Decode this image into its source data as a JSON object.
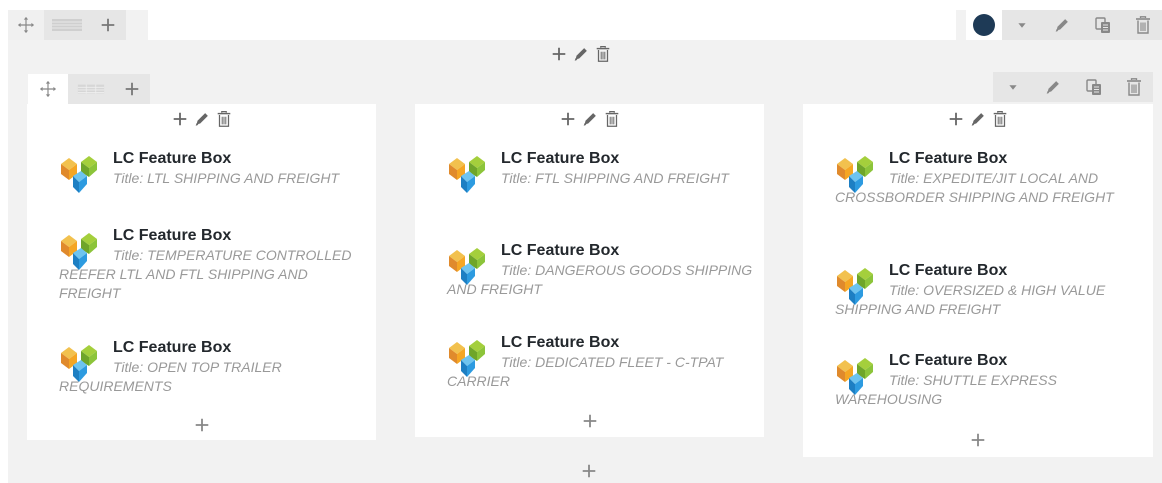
{
  "row": {
    "color_dot": "#1e3a56",
    "toolbar_icons": [
      "move-icon",
      "layout-icon",
      "plus-icon",
      "color-dot",
      "chevron-down-icon",
      "pencil-icon",
      "duplicate-icon",
      "trash-icon"
    ]
  },
  "section": {
    "toolbar_icons": [
      "move-icon",
      "layout-icon",
      "plus-icon",
      "chevron-down-icon",
      "pencil-icon",
      "duplicate-icon",
      "trash-icon"
    ]
  },
  "columns": [
    {
      "items": [
        {
          "name": "LC Feature Box",
          "subtitle": "Title: LTL SHIPPING AND FREIGHT"
        },
        {
          "name": "LC Feature Box",
          "subtitle": "Title: TEMPERATURE CONTROLLED REEFER LTL AND FTL SHIPPING AND FREIGHT"
        },
        {
          "name": "LC Feature Box",
          "subtitle": "Title: OPEN TOP TRAILER REQUIREMENTS"
        }
      ]
    },
    {
      "items": [
        {
          "name": "LC Feature Box",
          "subtitle": "Title: FTL SHIPPING AND FREIGHT"
        },
        {
          "name": "LC Feature Box",
          "subtitle": "Title: DANGEROUS GOODS SHIPPING AND FREIGHT"
        },
        {
          "name": "LC Feature Box",
          "subtitle": "Title: DEDICATED FLEET - C-TPAT CARRIER"
        }
      ]
    },
    {
      "items": [
        {
          "name": "LC Feature Box",
          "subtitle": "Title: EXPEDITE/JIT LOCAL AND CROSSBORDER SHIPPING AND FREIGHT"
        },
        {
          "name": "LC Feature Box",
          "subtitle": "Title: OVERSIZED & HIGH VALUE SHIPPING AND FREIGHT"
        },
        {
          "name": "LC Feature Box",
          "subtitle": "Title: SHUTTLE EXPRESS WAREHOUSING"
        }
      ]
    }
  ]
}
